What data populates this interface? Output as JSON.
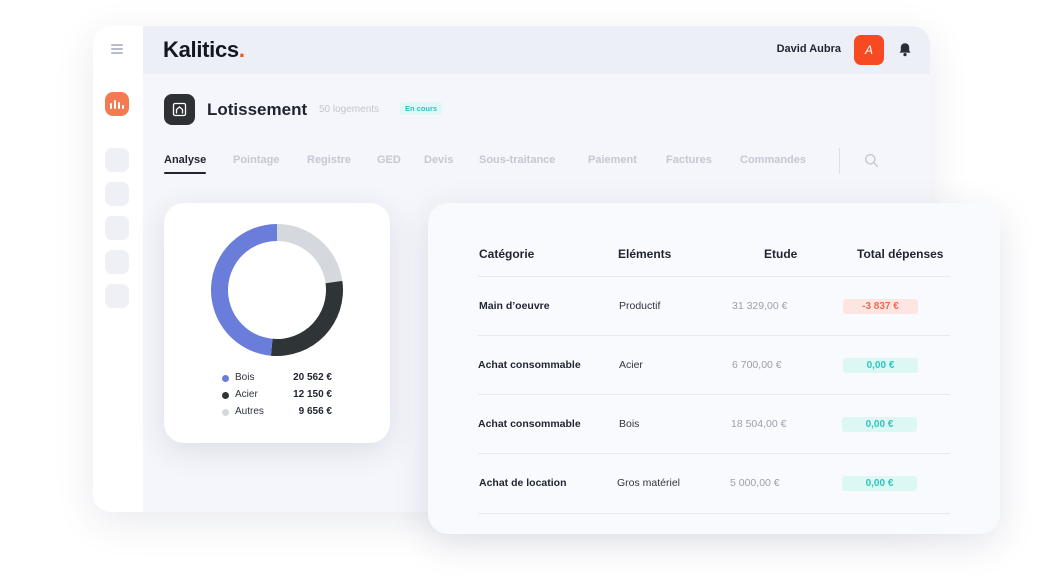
{
  "header": {
    "logo_text": "Kalitics",
    "logo_dot": ".",
    "user_name": "David Aubra",
    "avatar_initial": "A"
  },
  "project": {
    "title": "Lotissement",
    "count": "50 logements",
    "status": "En cours"
  },
  "tabs": [
    {
      "label": "Analyse",
      "active": true
    },
    {
      "label": "Pointage"
    },
    {
      "label": "Registre"
    },
    {
      "label": "GED"
    },
    {
      "label": "Devis"
    },
    {
      "label": "Sous-traitance"
    },
    {
      "label": "Paiement"
    },
    {
      "label": "Factures"
    },
    {
      "label": "Commandes"
    }
  ],
  "chart_data": {
    "type": "pie",
    "categories": [
      "Bois",
      "Acier",
      "Autres"
    ],
    "values": [
      20562,
      12150,
      9656
    ],
    "value_labels": [
      "20 562 €",
      "12 150 €",
      "9 656 €"
    ],
    "colors": [
      "#6b7ddb",
      "#2f3437",
      "#d5d8dd"
    ],
    "donut": true
  },
  "table": {
    "headers": [
      "Catégorie",
      "Eléments",
      "Etude",
      "Total dépenses"
    ],
    "rows": [
      {
        "categorie": "Main d’oeuvre",
        "elements": "Productif",
        "etude": "31 329,00 €",
        "total": "-3 837 €",
        "status": "negative"
      },
      {
        "categorie": "Achat consommable",
        "elements": "Acier",
        "etude": "6 700,00 €",
        "total": "0,00 €",
        "status": "positive"
      },
      {
        "categorie": "Achat consommable",
        "elements": "Bois",
        "etude": "18 504,00 €",
        "total": "0,00 €",
        "status": "positive"
      },
      {
        "categorie": "Achat de location",
        "elements": "Gros matériel",
        "etude": "5 000,00 €",
        "total": "0,00 €",
        "status": "positive"
      }
    ]
  },
  "colors": {
    "accent": "#f2511b",
    "avatar": "#f74a22",
    "sidebar_active": "#f47a52",
    "negative_text": "#f2694f",
    "positive_text": "#2ec5bd"
  },
  "icons": {
    "menu": "hamburger-icon",
    "sidebar_active": "bar-chart-icon",
    "notifications": "bell-icon",
    "project": "house-plan-icon",
    "search": "search-icon"
  }
}
